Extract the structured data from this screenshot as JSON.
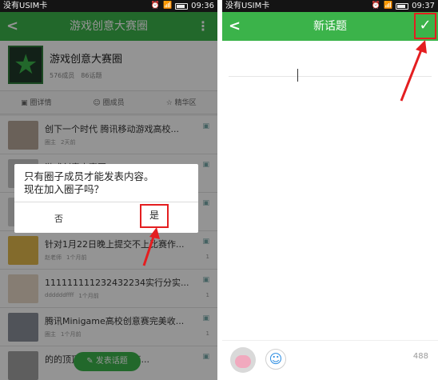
{
  "left": {
    "status": {
      "carrier": "没有USIM卡",
      "time": "09:36"
    },
    "appbar": {
      "title": "游戏创意大赛圈",
      "back": "<",
      "more": "⋮"
    },
    "circle": {
      "name": "游戏创意大赛圈",
      "members": "576成员",
      "topics": "86话题"
    },
    "tabs": [
      {
        "label": "圈详情",
        "icon": "info-icon"
      },
      {
        "label": "圈成员",
        "icon": "members-icon"
      },
      {
        "label": "精华区",
        "icon": "star-icon"
      }
    ],
    "posts": [
      {
        "title": "创下一个时代 腾讯移动游戏高校...",
        "author": "圈主",
        "time": "2天前",
        "avatar": "#b7a89a",
        "count": ""
      },
      {
        "title": "游戏创意大赛圈",
        "author": "",
        "time": "",
        "avatar": "#c9c9c9",
        "count": ""
      },
      {
        "title": "",
        "author": "",
        "time": "",
        "avatar": "#d4d4d4",
        "count": ""
      },
      {
        "title": "针对1月22日晚上提交不上比赛作...",
        "author": "赵老师",
        "time": "1个月前",
        "avatar": "#e2b84c",
        "count": "1"
      },
      {
        "title": "111111111232432234实行分实...",
        "author": "ddddddffff",
        "time": "1个月前",
        "avatar": "#e7d7c6",
        "count": "1"
      },
      {
        "title": "腾讯Minigame高校创意赛完美收...",
        "author": "圈主",
        "time": "1个月前",
        "avatar": "#8a8f9a",
        "count": "1"
      },
      {
        "title": "的的顶顶...地方实得分第...",
        "author": "",
        "time": "",
        "avatar": "#a3a3a3",
        "count": ""
      }
    ],
    "fab": "发表话题",
    "dialog": {
      "line1": "只有圈子成员才能发表内容。",
      "line2": "现在加入圈子吗？",
      "no": "否",
      "yes": "是"
    }
  },
  "right": {
    "status": {
      "carrier": "没有USIM卡",
      "time": "09:37"
    },
    "appbar": {
      "title": "新话题",
      "back": "<",
      "confirm": "✓"
    },
    "editor": {
      "title_value": "",
      "body_value": ""
    },
    "char_count": "488"
  },
  "colors": {
    "accent": "#3bb34a",
    "highlight": "#e41e20"
  }
}
